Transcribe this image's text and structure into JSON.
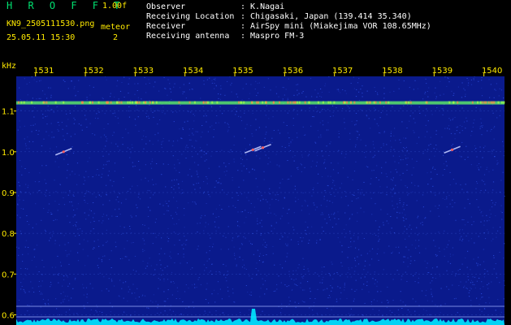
{
  "header": {
    "brand": "H R O F F T",
    "version": "1.00f",
    "filename": "KN9_2505111530.png",
    "timestamp": "25.05.11 15:30",
    "meteor_label": "meteor",
    "meteor_count": "2"
  },
  "metadata": [
    {
      "key": "Observer",
      "value": ": K.Nagai"
    },
    {
      "key": "Receiving Location",
      "value": ": Chigasaki, Japan (139.414 35.340)"
    },
    {
      "key": "Receiver",
      "value": ": AirSpy mini (Miakejima VOR 108.65MHz)"
    },
    {
      "key": "Receiving antenna",
      "value": ": Maspro FM-3"
    }
  ],
  "spectrogram": {
    "y_unit": "kHz",
    "y_ticks": [
      "1.1",
      "1.0",
      "0.9",
      "0.8",
      "0.7",
      "0.6"
    ],
    "y_values": [
      1.1,
      1.0,
      0.9,
      0.8,
      0.7,
      0.6
    ],
    "y_range": [
      0.575,
      1.185
    ],
    "time_ticks": [
      "1531",
      "1532",
      "1533",
      "1534",
      "1535",
      "1536",
      "1537",
      "1538",
      "1539",
      "1540"
    ],
    "time_range": [
      1530.45,
      1540.25
    ],
    "carrier_khz": 1.12,
    "meteors": [
      {
        "t": 1531.4,
        "khz": 1.0
      },
      {
        "t": 1535.2,
        "khz": 1.005
      },
      {
        "t": 1535.4,
        "khz": 1.01
      },
      {
        "t": 1539.2,
        "khz": 1.005
      }
    ],
    "colors": {
      "background": "#0a1a8c",
      "grid": "#3050c8",
      "noise": "#2c4ee0",
      "carrier": "#66ff66",
      "meteor": "#ff6060",
      "baseline": "#00e8ff",
      "labels": "#ffea00"
    }
  }
}
